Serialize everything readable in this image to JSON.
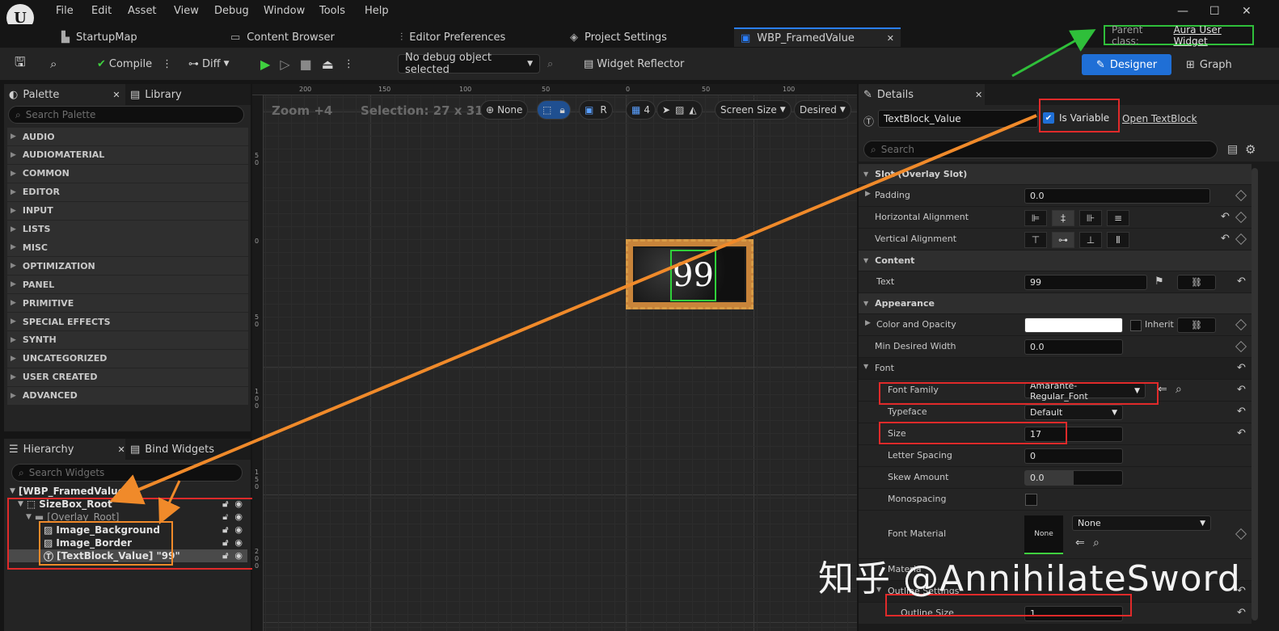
{
  "menu": {
    "items": [
      "File",
      "Edit",
      "Asset",
      "View",
      "Debug",
      "Window",
      "Tools",
      "Help"
    ]
  },
  "window_controls": {
    "minimize": "—",
    "maximize": "☐",
    "close": "✕"
  },
  "tabs": [
    {
      "label": "StartupMap",
      "icon": "level-icon"
    },
    {
      "label": "Content Browser",
      "icon": "folder-icon"
    },
    {
      "label": "Editor Preferences",
      "icon": "sliders-icon"
    },
    {
      "label": "Project Settings",
      "icon": "cube-icon"
    },
    {
      "label": "WBP_FramedValue",
      "icon": "widget-icon",
      "active": true,
      "close": "✕"
    }
  ],
  "parent_class": {
    "label": "Parent class:",
    "value": "Aura User Widget"
  },
  "toolbar": {
    "compile": "Compile",
    "diff": "Diff",
    "debug_object": "No debug object selected",
    "widget_reflector": "Widget Reflector",
    "designer": "Designer",
    "graph": "Graph"
  },
  "palette": {
    "tab": "Palette",
    "library_tab": "Library",
    "search_placeholder": "Search Palette",
    "categories": [
      "AUDIO",
      "AUDIOMATERIAL",
      "COMMON",
      "EDITOR",
      "INPUT",
      "LISTS",
      "MISC",
      "OPTIMIZATION",
      "PANEL",
      "PRIMITIVE",
      "SPECIAL EFFECTS",
      "SYNTH",
      "UNCATEGORIZED",
      "USER CREATED",
      "ADVANCED"
    ]
  },
  "hierarchy": {
    "tab": "Hierarchy",
    "bind_tab": "Bind Widgets",
    "search_placeholder": "Search Widgets",
    "root": "[WBP_FramedValue]",
    "items": [
      {
        "label": "SizeBox_Root"
      },
      {
        "label": "[Overlay_Root]"
      },
      {
        "label": "Image_Background"
      },
      {
        "label": "Image_Border"
      },
      {
        "label": "[TextBlock_Value] \"99\""
      }
    ]
  },
  "canvas": {
    "zoom": "Zoom +4",
    "selection": "Selection: 27 x 31",
    "none_btn": "None",
    "r_btn": "R",
    "grid_num": "4",
    "screen_size": "Screen Size",
    "desired": "Desired",
    "widget_text": "99",
    "ruler_top": [
      "200",
      "150",
      "100",
      "50",
      "0",
      "50",
      "100"
    ],
    "ruler_left": [
      "50",
      "0",
      "50",
      "100",
      "150",
      "200"
    ]
  },
  "details": {
    "tab": "Details",
    "widget_name": "TextBlock_Value",
    "is_variable": "Is Variable",
    "open_link": "Open TextBlock",
    "search_placeholder": "Search",
    "slot_section": "Slot (Overlay Slot)",
    "padding_label": "Padding",
    "padding_value": "0.0",
    "halign_label": "Horizontal Alignment",
    "valign_label": "Vertical Alignment",
    "content_section": "Content",
    "text_label": "Text",
    "text_value": "99",
    "appearance_section": "Appearance",
    "color_label": "Color and Opacity",
    "inherit": "Inherit",
    "min_width_label": "Min Desired Width",
    "min_width_value": "0.0",
    "font_section": "Font",
    "font_family_label": "Font Family",
    "font_family_value": "Amarante-Regular_Font",
    "typeface_label": "Typeface",
    "typeface_value": "Default",
    "size_label": "Size",
    "size_value": "17",
    "letter_spacing_label": "Letter Spacing",
    "letter_spacing_value": "0",
    "skew_label": "Skew Amount",
    "skew_value": "0.0",
    "mono_label": "Monospacing",
    "font_material_label": "Font Material",
    "font_material_value": "None",
    "font_material_thumb": "None",
    "material_partial": "Materia",
    "outline_section": "Outline Settings",
    "outline_size_label": "Outline Size",
    "outline_size_value": "1"
  },
  "watermark": "知乎 @AnnihilateSword",
  "colors": {
    "accent": "#1f6fd6",
    "green_annot": "#2fbf3a",
    "red_annot": "#e02a2a",
    "orange_annot": "#f08a2a"
  }
}
